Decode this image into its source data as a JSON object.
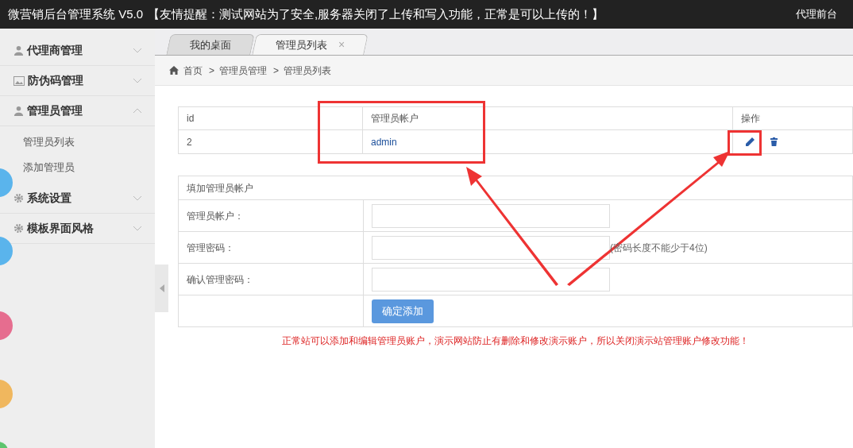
{
  "header": {
    "title": "微营销后台管理系统 V5.0",
    "notice": "【友情提醒：测试网站为了安全,服务器关闭了上传和写入功能，正常是可以上传的！】",
    "link": "代理前台"
  },
  "sidebar": {
    "items": [
      {
        "label": "代理商管理",
        "kind": "user",
        "expanded": false
      },
      {
        "label": "防伪码管理",
        "kind": "image",
        "expanded": false
      },
      {
        "label": "管理员管理",
        "kind": "user",
        "expanded": true,
        "children": [
          {
            "label": "管理员列表"
          },
          {
            "label": "添加管理员"
          }
        ]
      },
      {
        "label": "系统设置",
        "kind": "gear",
        "expanded": false
      },
      {
        "label": "模板界面风格",
        "kind": "gear",
        "expanded": false
      }
    ]
  },
  "tabs": [
    {
      "label": "我的桌面",
      "selected": false,
      "closable": false
    },
    {
      "label": "管理员列表",
      "selected": true,
      "closable": true,
      "close": "×"
    }
  ],
  "breadcrumb": [
    "首页",
    "管理员管理",
    "管理员列表"
  ],
  "breadcrumb_separator": ">",
  "table": {
    "columns": [
      "id",
      "管理员帐户",
      "操作"
    ],
    "rows": [
      {
        "id": "2",
        "account": "admin"
      }
    ]
  },
  "form": {
    "title": "填加管理员帐户",
    "fields": [
      {
        "label": "管理员帐户："
      },
      {
        "label": "管理密码：",
        "hint": "(密码长度不能少于4位)"
      },
      {
        "label": "确认管理密码："
      }
    ],
    "submit": "确定添加"
  },
  "note": "正常站可以添加和编辑管理员账户，演示网站防止有删除和修改演示账户，所以关闭演示站管理账户修改功能！"
}
